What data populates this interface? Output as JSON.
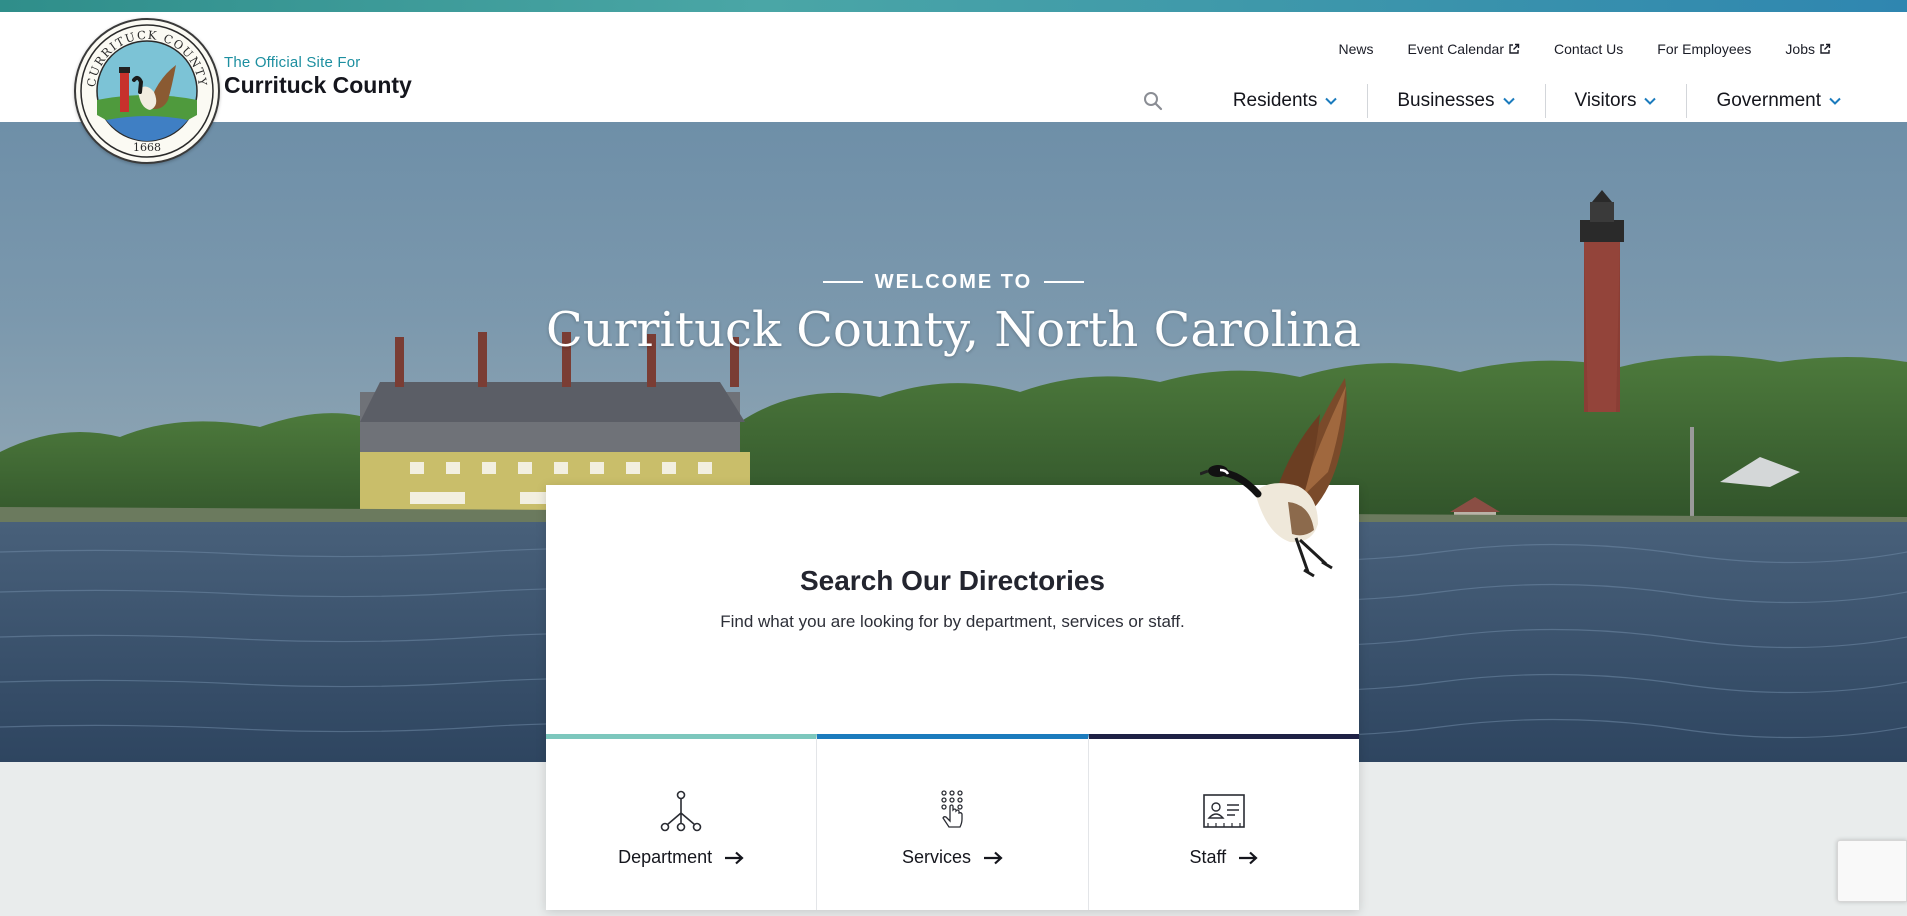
{
  "brand": {
    "seal_alt": "Currituck County seal",
    "seal_text_top": "CURRITUCK COUNTY",
    "seal_year": "1668",
    "subtitle": "The Official Site For",
    "name": "Currituck County"
  },
  "utility_nav": [
    {
      "label": "News",
      "external": false
    },
    {
      "label": "Event Calendar",
      "external": true
    },
    {
      "label": "Contact Us",
      "external": false
    },
    {
      "label": "For Employees",
      "external": false
    },
    {
      "label": "Jobs",
      "external": true
    }
  ],
  "main_nav": [
    {
      "label": "Residents"
    },
    {
      "label": "Businesses"
    },
    {
      "label": "Visitors"
    },
    {
      "label": "Government"
    }
  ],
  "hero": {
    "eyebrow": "WELCOME TO",
    "title": "Currituck County, North Carolina"
  },
  "directory": {
    "title": "Search Our Directories",
    "subtitle": "Find what you are looking for by department, services or staff.",
    "tiles": [
      {
        "label": "Department",
        "icon": "org-chart-icon",
        "accent": "#7cc7bd"
      },
      {
        "label": "Services",
        "icon": "keypad-hand-icon",
        "accent": "#1b7bbd"
      },
      {
        "label": "Staff",
        "icon": "id-card-icon",
        "accent": "#1e2145"
      }
    ]
  },
  "colors": {
    "accent_teal": "#1d8fa0",
    "chevron_blue": "#1b7bbd",
    "navy": "#1e2145"
  }
}
